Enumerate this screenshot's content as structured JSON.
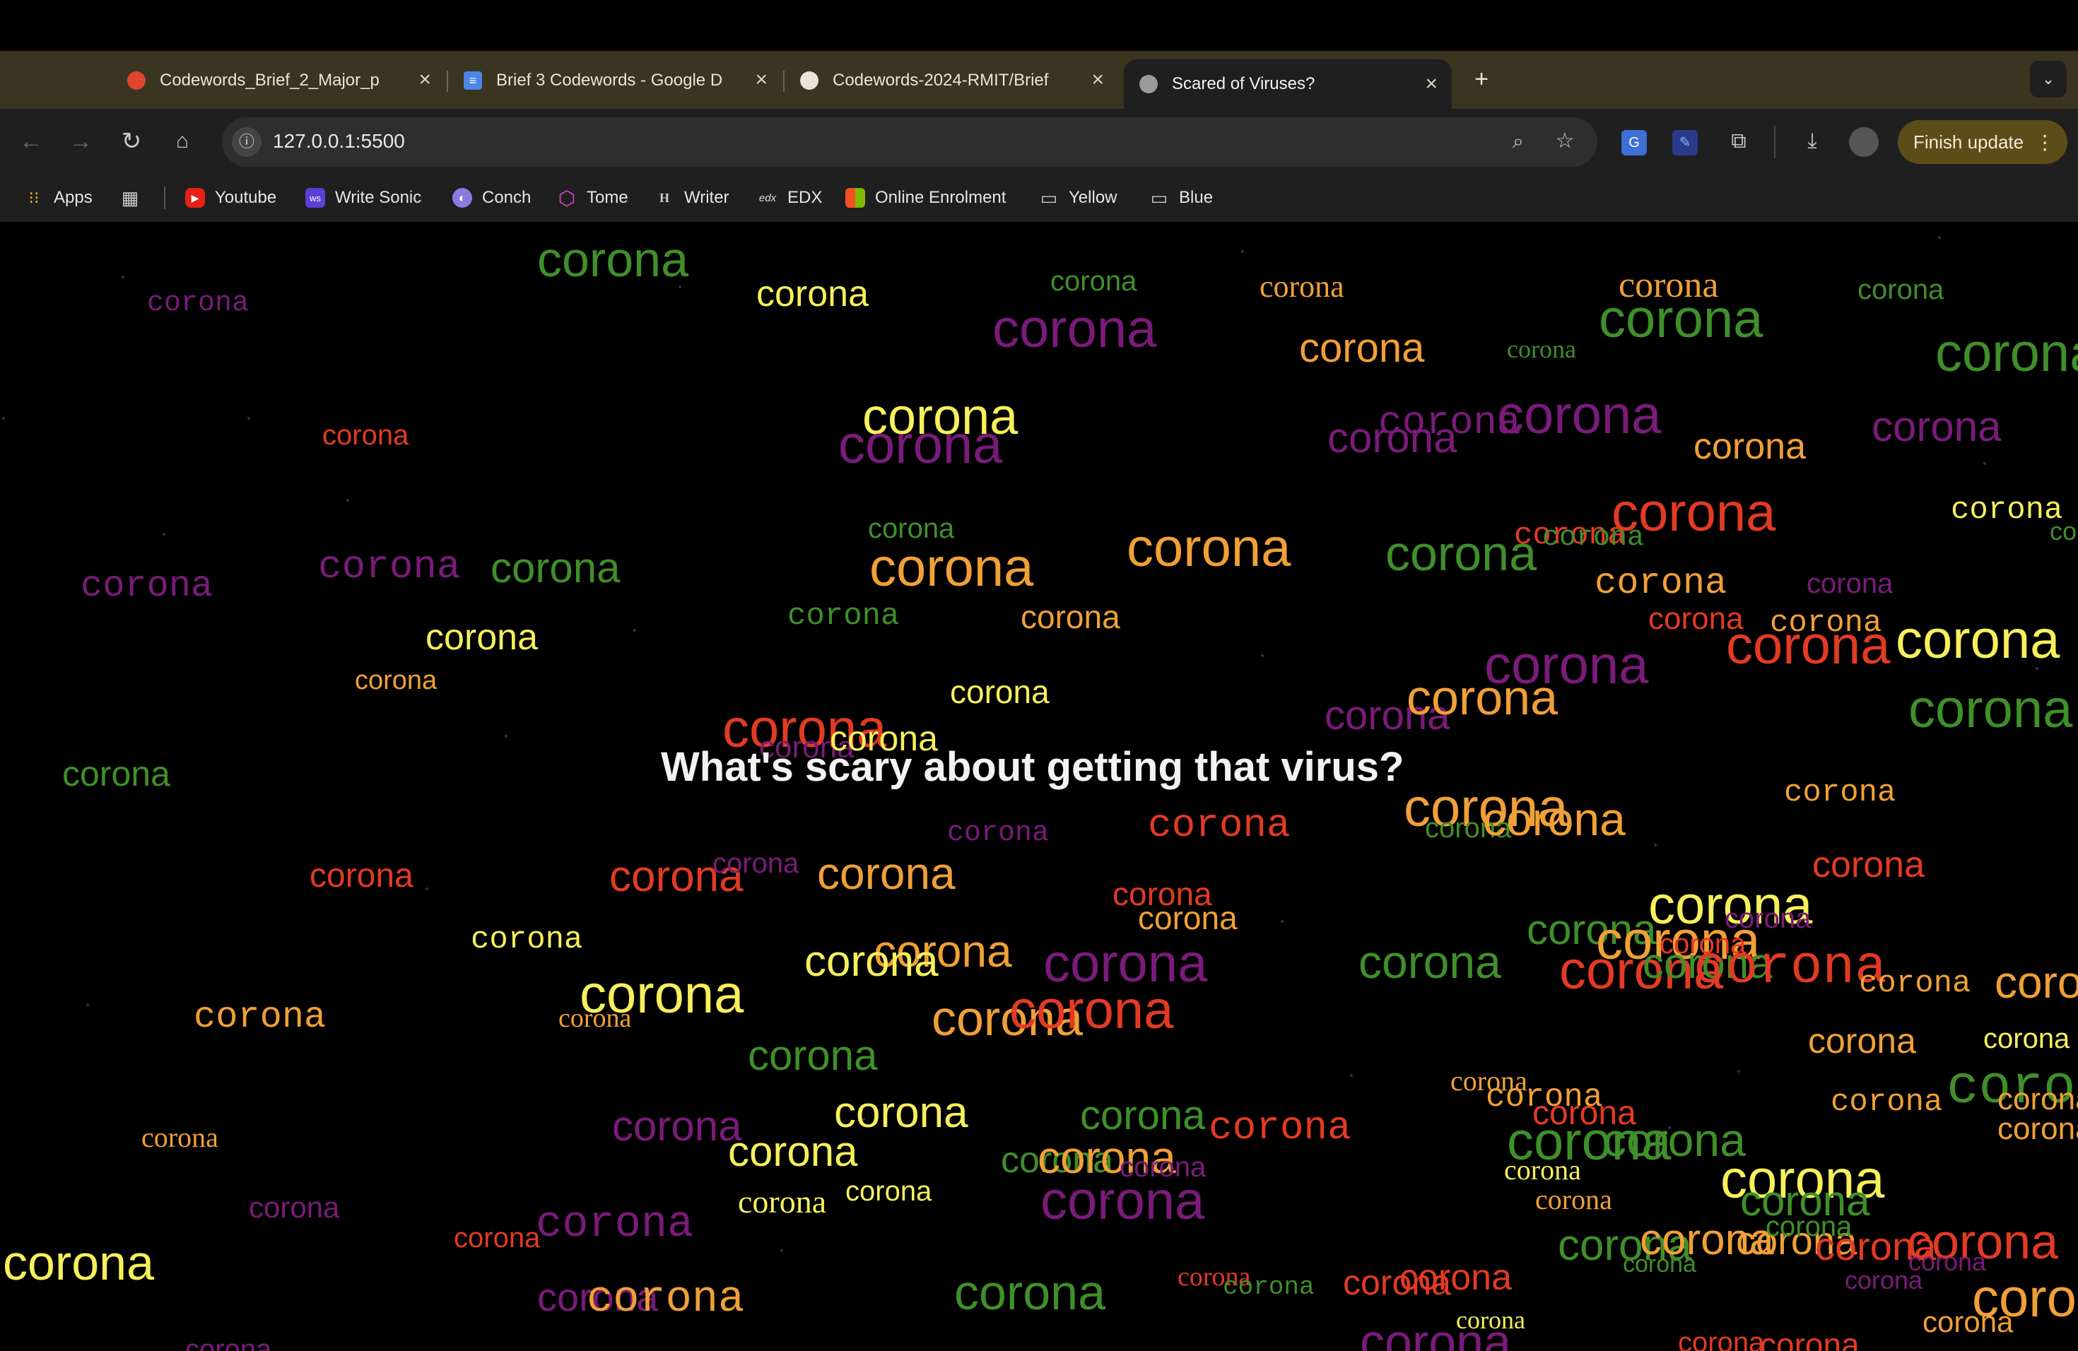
{
  "tabs": [
    {
      "title": "Codewords_Brief_2_Major_p",
      "icon": "red-app-icon"
    },
    {
      "title": "Brief 3 Codewords - Google D",
      "icon": "google-docs-icon"
    },
    {
      "title": "Codewords-2024-RMIT/Brief",
      "icon": "github-icon"
    },
    {
      "title": "Scared of Viruses?",
      "icon": "globe-icon",
      "active": true
    }
  ],
  "toolbar": {
    "url": "127.0.0.1:5500",
    "finish_update": "Finish update"
  },
  "bookmarks": [
    {
      "label": "Apps",
      "icon": "apps-grid-icon"
    },
    {
      "label": "",
      "icon": "tab-groups-icon"
    },
    {
      "label": "Youtube",
      "icon": "youtube-icon"
    },
    {
      "label": "Write Sonic",
      "icon": "writesonic-icon"
    },
    {
      "label": "Conch",
      "icon": "conch-icon"
    },
    {
      "label": "Tome",
      "icon": "tome-icon"
    },
    {
      "label": "Writer",
      "icon": "writer-icon"
    },
    {
      "label": "EDX",
      "icon": "edx-icon"
    },
    {
      "label": "Online Enrolment",
      "icon": "microsoft-icon"
    },
    {
      "label": "Yellow",
      "icon": "folder-icon"
    },
    {
      "label": "Blue",
      "icon": "folder-icon"
    }
  ],
  "page": {
    "headline": "What's scary about getting that virus?",
    "word": "corona",
    "colors": {
      "green": "#3f8f2a",
      "purple": "#7a1b7a",
      "orange": "#f0a036",
      "yellow": "#f6f05a",
      "red": "#e23a24"
    }
  }
}
